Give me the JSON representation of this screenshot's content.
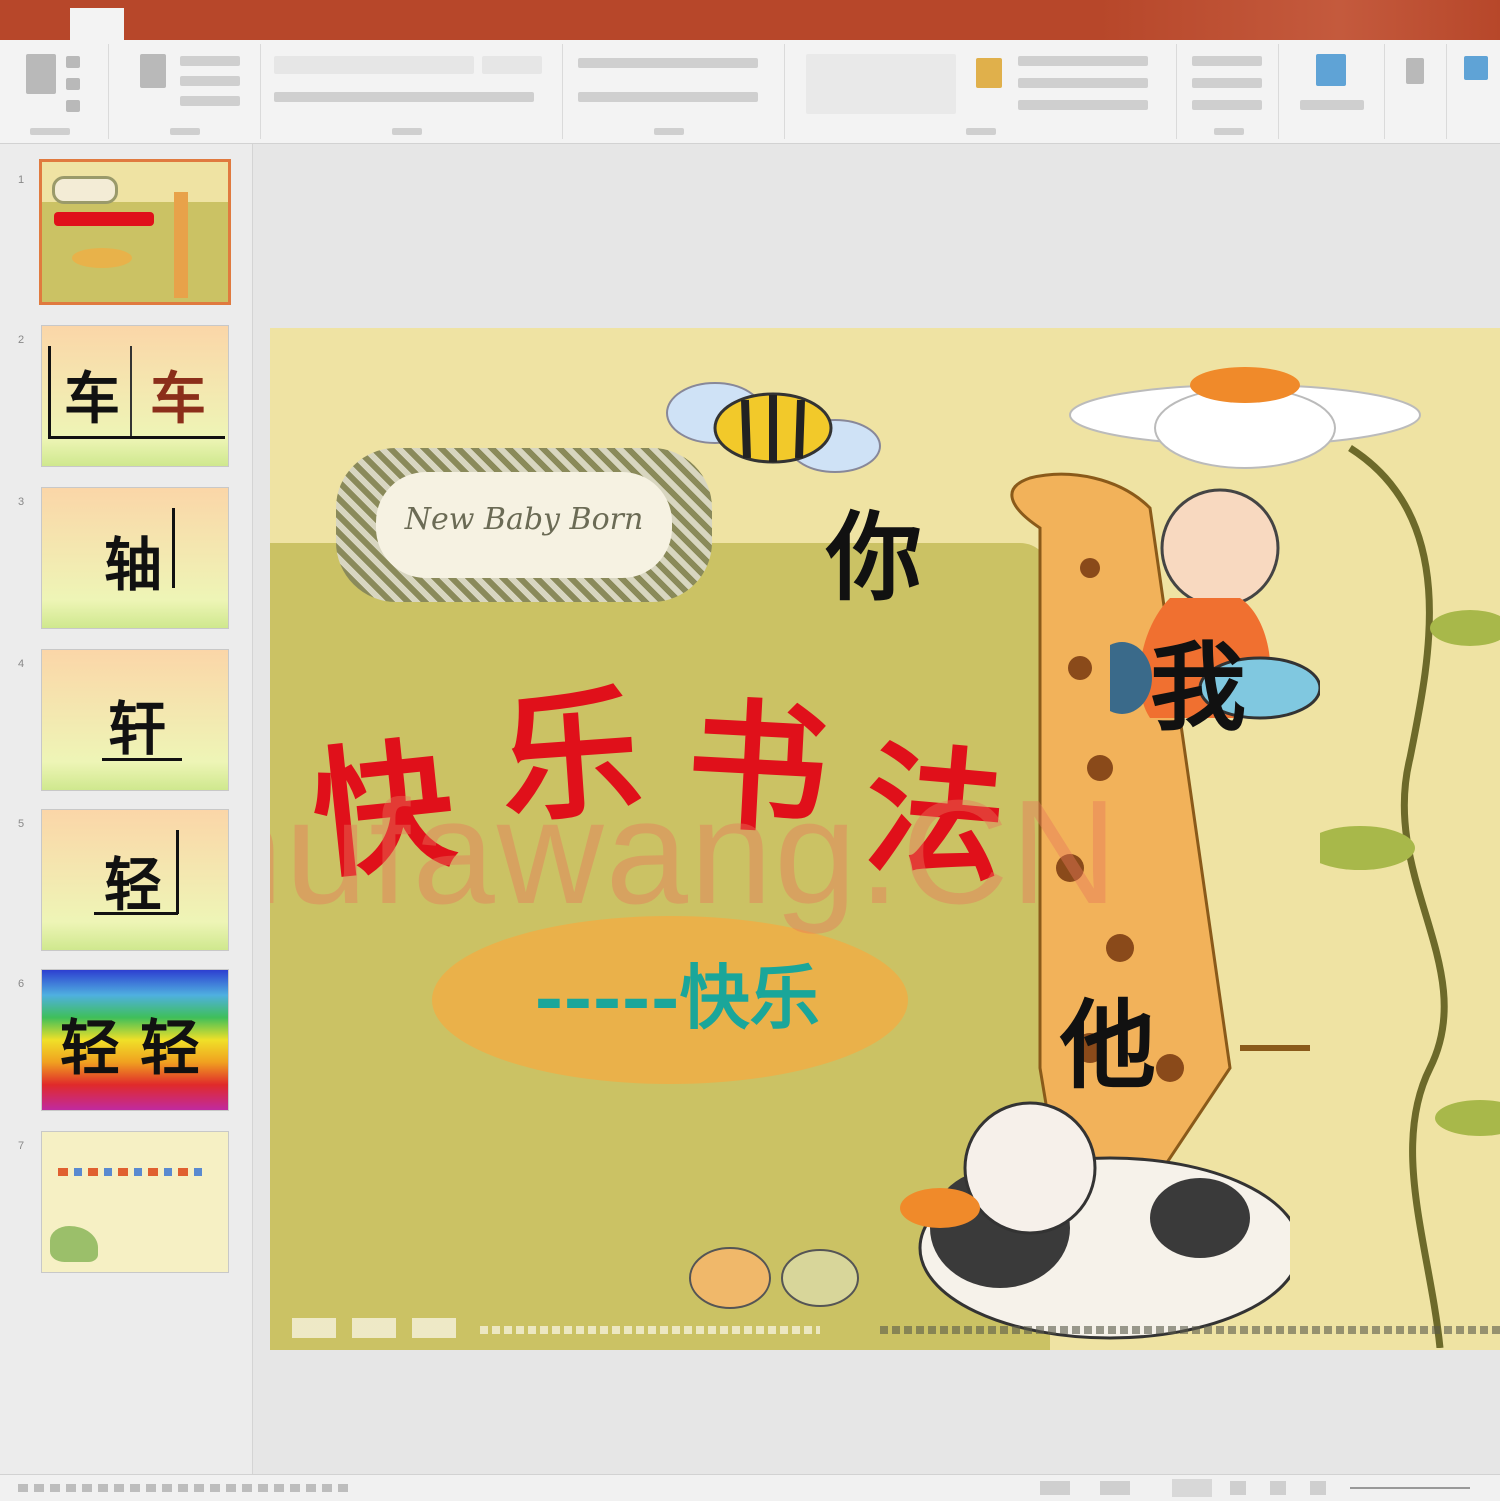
{
  "ribbon_tabs": [
    "",
    "",
    "",
    "",
    "",
    "",
    "",
    "",
    "",
    "",
    "",
    "",
    "",
    "",
    "",
    ""
  ],
  "slides": [
    {
      "number": "1",
      "type": "title"
    },
    {
      "number": "2",
      "chars": [
        "车",
        "车"
      ]
    },
    {
      "number": "3",
      "chars": [
        "轴"
      ]
    },
    {
      "number": "4",
      "chars": [
        "轩"
      ]
    },
    {
      "number": "5",
      "chars": [
        "轻"
      ]
    },
    {
      "number": "6",
      "chars": [
        "轻",
        "轻"
      ]
    },
    {
      "number": "7",
      "type": "end"
    }
  ],
  "slide": {
    "label_text": "New Baby Born",
    "title_chars": [
      "快",
      "乐",
      "书",
      "法"
    ],
    "subtitle_dashes": "-----",
    "subtitle": "快乐",
    "pronouns": [
      "你",
      "我",
      "他"
    ],
    "watermark": "Shufawang.CN"
  },
  "status": {
    "left": ""
  },
  "colors": {
    "accent": "#b7472a",
    "title_red": "#e0101a",
    "subtitle_teal": "#1aa69a"
  }
}
